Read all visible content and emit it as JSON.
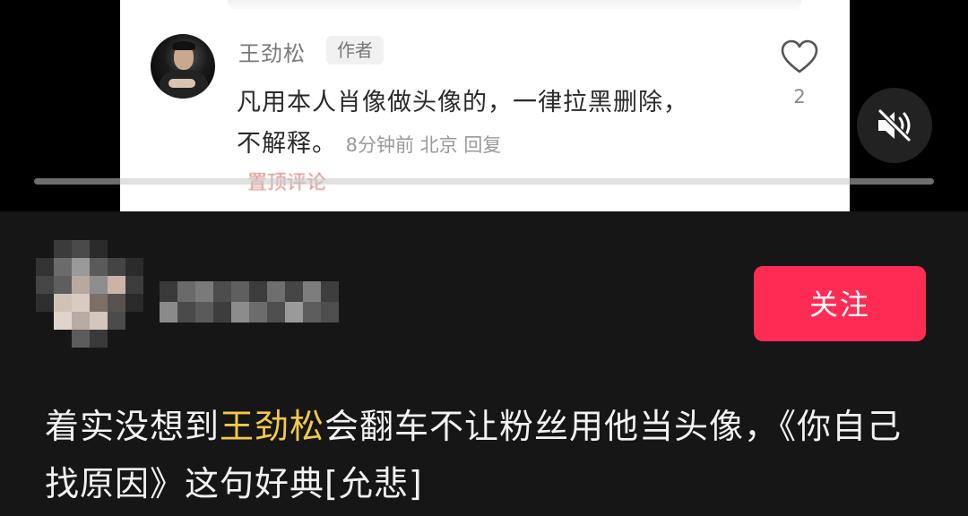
{
  "comment": {
    "username": "王劲松",
    "badge": "作者",
    "text": "凡用本人肖像做头像的，一律拉黑删除，不解释。",
    "time": "8分钟前",
    "location": "北京",
    "reply": "回复",
    "likes": "2",
    "pinned": "置顶评论"
  },
  "video": {
    "progress": 0.0
  },
  "profile": {
    "follow_label": "关注"
  },
  "caption": {
    "before": "着实没想到",
    "mention": "王劲松",
    "after": "会翻车不让粉丝用他当头像，《你自己找原因》这句好典[允悲]"
  },
  "colors": {
    "follow": "#fe2c55",
    "mention": "#f2c94c"
  },
  "icons": [
    "heart-icon",
    "mute-icon"
  ]
}
